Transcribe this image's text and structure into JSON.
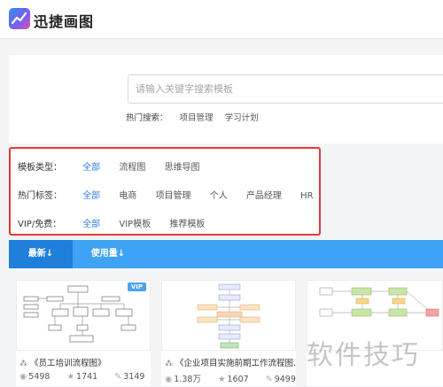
{
  "app": {
    "brand": "迅捷画图"
  },
  "search": {
    "placeholder": "请输入关键字搜索模板",
    "hot_label": "热门搜索：",
    "hot_keywords": [
      "项目管理",
      "学习计划"
    ]
  },
  "filters": {
    "type": {
      "label": "模板类型：",
      "options": [
        "全部",
        "流程图",
        "思维导图"
      ],
      "active": "全部"
    },
    "tags": {
      "label": "热门标签：",
      "options": [
        "全部",
        "电商",
        "项目管理",
        "个人",
        "产品经理",
        "HR"
      ],
      "active": "全部"
    },
    "vip": {
      "label": "VIP/免费：",
      "options": [
        "全部",
        "VIP模板",
        "推荐模板"
      ],
      "active": "全部"
    }
  },
  "sort": {
    "tabs": [
      "最新↓",
      "使用量↓"
    ],
    "active": "最新↓"
  },
  "cards": [
    {
      "title": "《员工培训流程图》",
      "views": "5498",
      "likes": "1741",
      "edits": "3149",
      "badge": "VIP"
    },
    {
      "title": "《企业项目实施前期工作流程图...",
      "views": "1.38万",
      "likes": "1607",
      "edits": "9499"
    },
    {
      "title": "",
      "views": "",
      "likes": "",
      "edits": ""
    }
  ],
  "watermark": "软件技巧",
  "colors": {
    "accent": "#2b7de9",
    "sortbar": "#3ea3f5",
    "highlight_border": "#e23a3a"
  }
}
